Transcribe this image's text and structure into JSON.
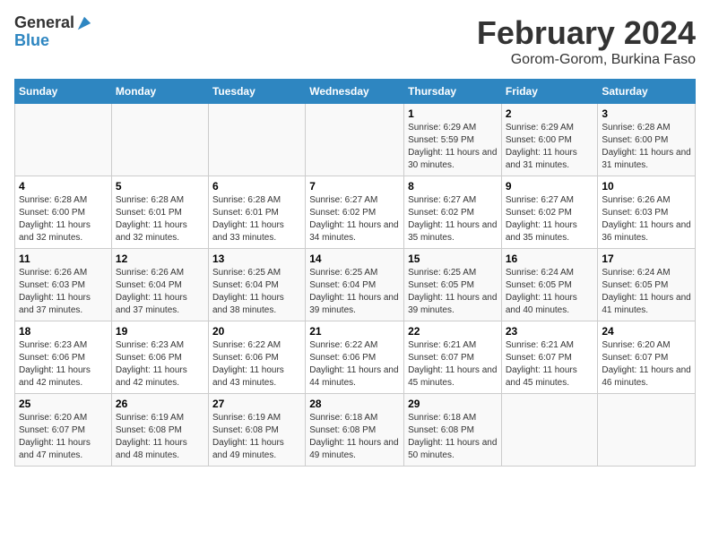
{
  "logo": {
    "general": "General",
    "blue": "Blue"
  },
  "title": "February 2024",
  "subtitle": "Gorom-Gorom, Burkina Faso",
  "days_header": [
    "Sunday",
    "Monday",
    "Tuesday",
    "Wednesday",
    "Thursday",
    "Friday",
    "Saturday"
  ],
  "weeks": [
    [
      {
        "day": "",
        "detail": ""
      },
      {
        "day": "",
        "detail": ""
      },
      {
        "day": "",
        "detail": ""
      },
      {
        "day": "",
        "detail": ""
      },
      {
        "day": "1",
        "detail": "Sunrise: 6:29 AM\nSunset: 5:59 PM\nDaylight: 11 hours and 30 minutes."
      },
      {
        "day": "2",
        "detail": "Sunrise: 6:29 AM\nSunset: 6:00 PM\nDaylight: 11 hours and 31 minutes."
      },
      {
        "day": "3",
        "detail": "Sunrise: 6:28 AM\nSunset: 6:00 PM\nDaylight: 11 hours and 31 minutes."
      }
    ],
    [
      {
        "day": "4",
        "detail": "Sunrise: 6:28 AM\nSunset: 6:00 PM\nDaylight: 11 hours and 32 minutes."
      },
      {
        "day": "5",
        "detail": "Sunrise: 6:28 AM\nSunset: 6:01 PM\nDaylight: 11 hours and 32 minutes."
      },
      {
        "day": "6",
        "detail": "Sunrise: 6:28 AM\nSunset: 6:01 PM\nDaylight: 11 hours and 33 minutes."
      },
      {
        "day": "7",
        "detail": "Sunrise: 6:27 AM\nSunset: 6:02 PM\nDaylight: 11 hours and 34 minutes."
      },
      {
        "day": "8",
        "detail": "Sunrise: 6:27 AM\nSunset: 6:02 PM\nDaylight: 11 hours and 35 minutes."
      },
      {
        "day": "9",
        "detail": "Sunrise: 6:27 AM\nSunset: 6:02 PM\nDaylight: 11 hours and 35 minutes."
      },
      {
        "day": "10",
        "detail": "Sunrise: 6:26 AM\nSunset: 6:03 PM\nDaylight: 11 hours and 36 minutes."
      }
    ],
    [
      {
        "day": "11",
        "detail": "Sunrise: 6:26 AM\nSunset: 6:03 PM\nDaylight: 11 hours and 37 minutes."
      },
      {
        "day": "12",
        "detail": "Sunrise: 6:26 AM\nSunset: 6:04 PM\nDaylight: 11 hours and 37 minutes."
      },
      {
        "day": "13",
        "detail": "Sunrise: 6:25 AM\nSunset: 6:04 PM\nDaylight: 11 hours and 38 minutes."
      },
      {
        "day": "14",
        "detail": "Sunrise: 6:25 AM\nSunset: 6:04 PM\nDaylight: 11 hours and 39 minutes."
      },
      {
        "day": "15",
        "detail": "Sunrise: 6:25 AM\nSunset: 6:05 PM\nDaylight: 11 hours and 39 minutes."
      },
      {
        "day": "16",
        "detail": "Sunrise: 6:24 AM\nSunset: 6:05 PM\nDaylight: 11 hours and 40 minutes."
      },
      {
        "day": "17",
        "detail": "Sunrise: 6:24 AM\nSunset: 6:05 PM\nDaylight: 11 hours and 41 minutes."
      }
    ],
    [
      {
        "day": "18",
        "detail": "Sunrise: 6:23 AM\nSunset: 6:06 PM\nDaylight: 11 hours and 42 minutes."
      },
      {
        "day": "19",
        "detail": "Sunrise: 6:23 AM\nSunset: 6:06 PM\nDaylight: 11 hours and 42 minutes."
      },
      {
        "day": "20",
        "detail": "Sunrise: 6:22 AM\nSunset: 6:06 PM\nDaylight: 11 hours and 43 minutes."
      },
      {
        "day": "21",
        "detail": "Sunrise: 6:22 AM\nSunset: 6:06 PM\nDaylight: 11 hours and 44 minutes."
      },
      {
        "day": "22",
        "detail": "Sunrise: 6:21 AM\nSunset: 6:07 PM\nDaylight: 11 hours and 45 minutes."
      },
      {
        "day": "23",
        "detail": "Sunrise: 6:21 AM\nSunset: 6:07 PM\nDaylight: 11 hours and 45 minutes."
      },
      {
        "day": "24",
        "detail": "Sunrise: 6:20 AM\nSunset: 6:07 PM\nDaylight: 11 hours and 46 minutes."
      }
    ],
    [
      {
        "day": "25",
        "detail": "Sunrise: 6:20 AM\nSunset: 6:07 PM\nDaylight: 11 hours and 47 minutes."
      },
      {
        "day": "26",
        "detail": "Sunrise: 6:19 AM\nSunset: 6:08 PM\nDaylight: 11 hours and 48 minutes."
      },
      {
        "day": "27",
        "detail": "Sunrise: 6:19 AM\nSunset: 6:08 PM\nDaylight: 11 hours and 49 minutes."
      },
      {
        "day": "28",
        "detail": "Sunrise: 6:18 AM\nSunset: 6:08 PM\nDaylight: 11 hours and 49 minutes."
      },
      {
        "day": "29",
        "detail": "Sunrise: 6:18 AM\nSunset: 6:08 PM\nDaylight: 11 hours and 50 minutes."
      },
      {
        "day": "",
        "detail": ""
      },
      {
        "day": "",
        "detail": ""
      }
    ]
  ]
}
